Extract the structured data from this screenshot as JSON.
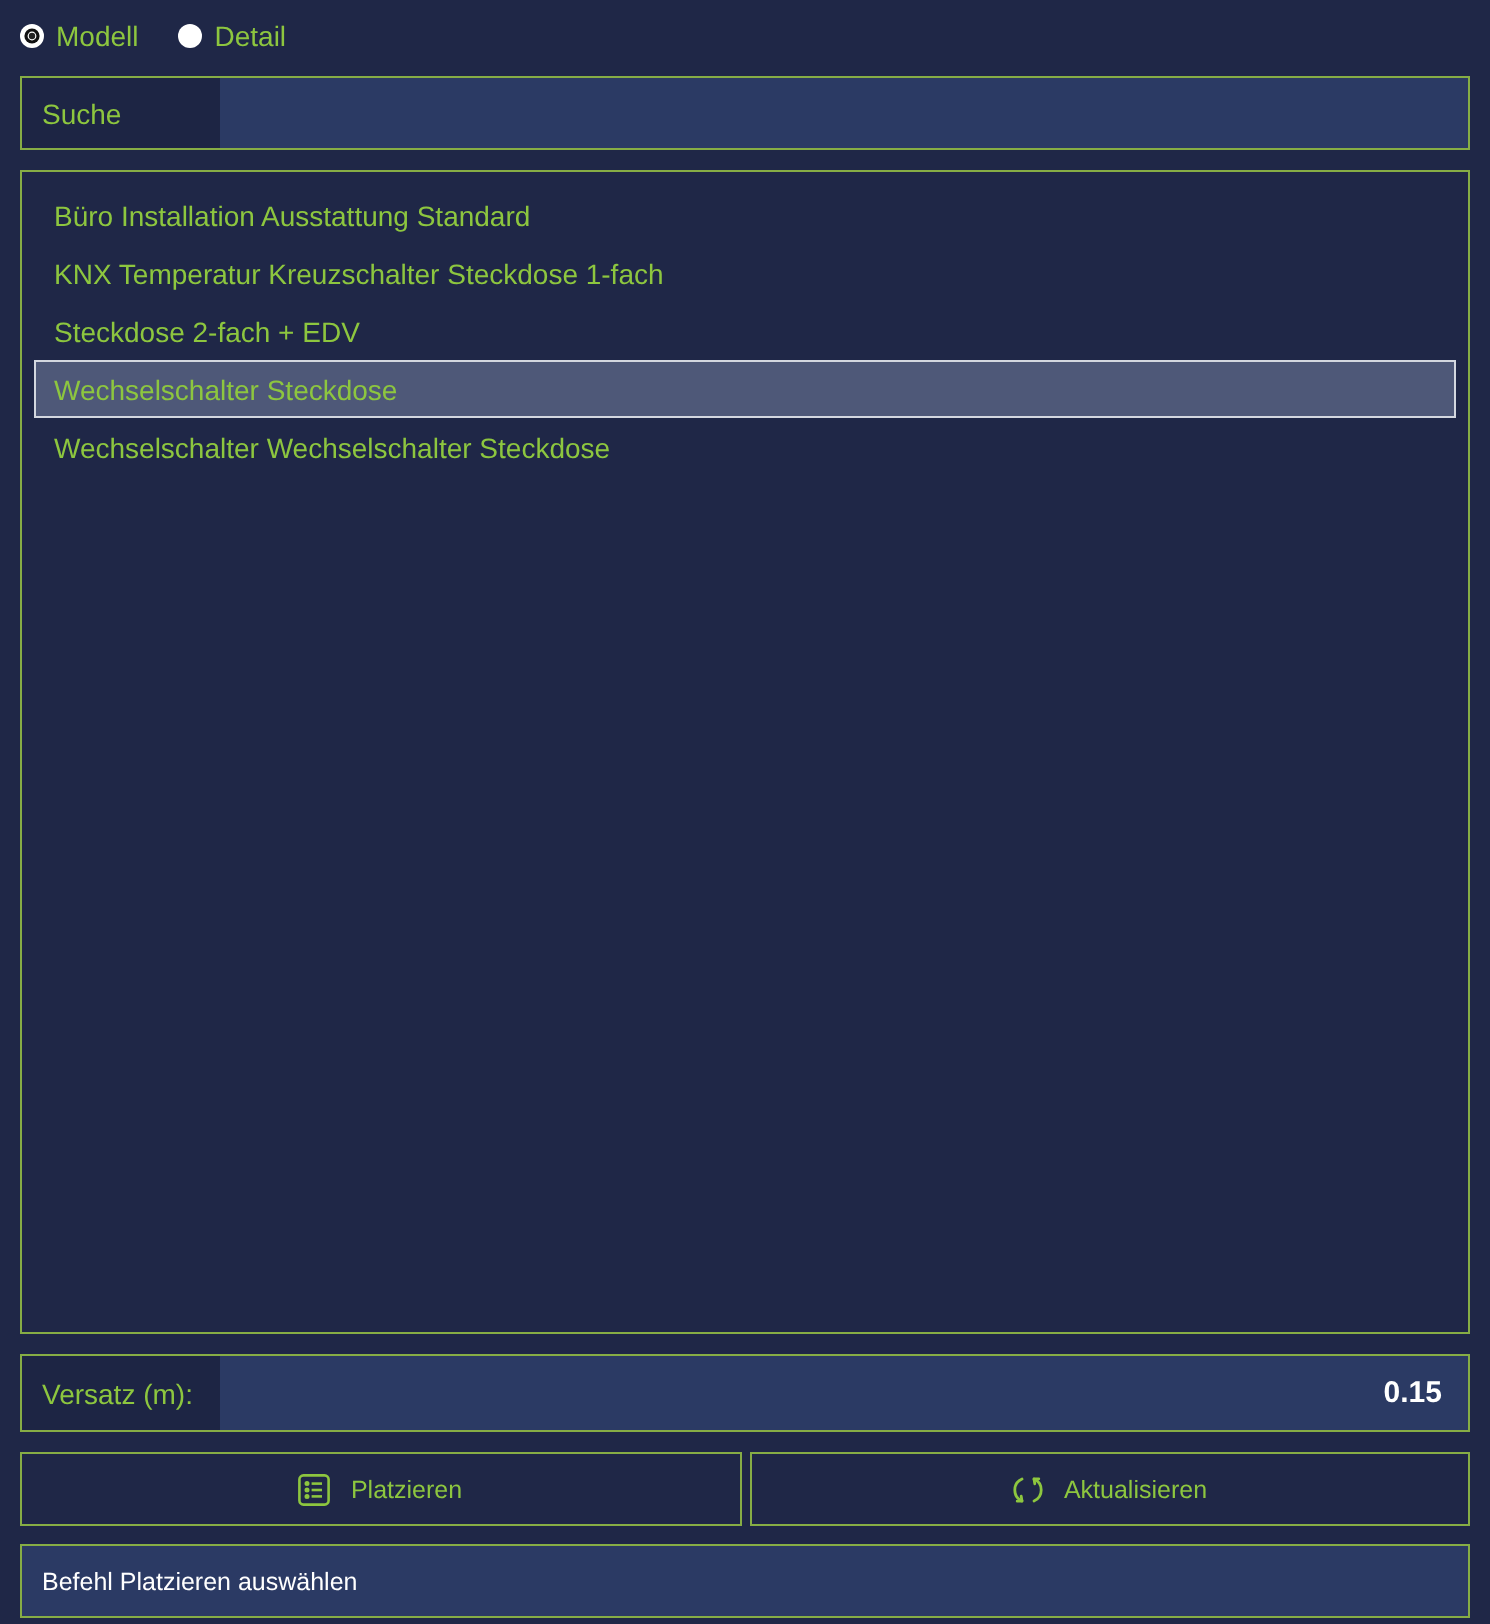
{
  "view_options": [
    {
      "label": "Modell",
      "selected": true
    },
    {
      "label": "Detail",
      "selected": false
    }
  ],
  "search": {
    "label": "Suche"
  },
  "list": {
    "items": [
      {
        "label": "Büro Installation Ausstattung Standard",
        "selected": false
      },
      {
        "label": "KNX Temperatur Kreuzschalter Steckdose 1-fach",
        "selected": false
      },
      {
        "label": "Steckdose 2-fach + EDV",
        "selected": false
      },
      {
        "label": "Wechselschalter Steckdose",
        "selected": true
      },
      {
        "label": "Wechselschalter Wechselschalter Steckdose",
        "selected": false
      }
    ]
  },
  "offset": {
    "label": "Versatz (m):",
    "value": "0.15"
  },
  "buttons": [
    {
      "label": "Platzieren",
      "kind": "place"
    },
    {
      "label": "Aktualisieren",
      "kind": "refresh"
    }
  ],
  "status_bar": "Befehl Platzieren auswählen"
}
